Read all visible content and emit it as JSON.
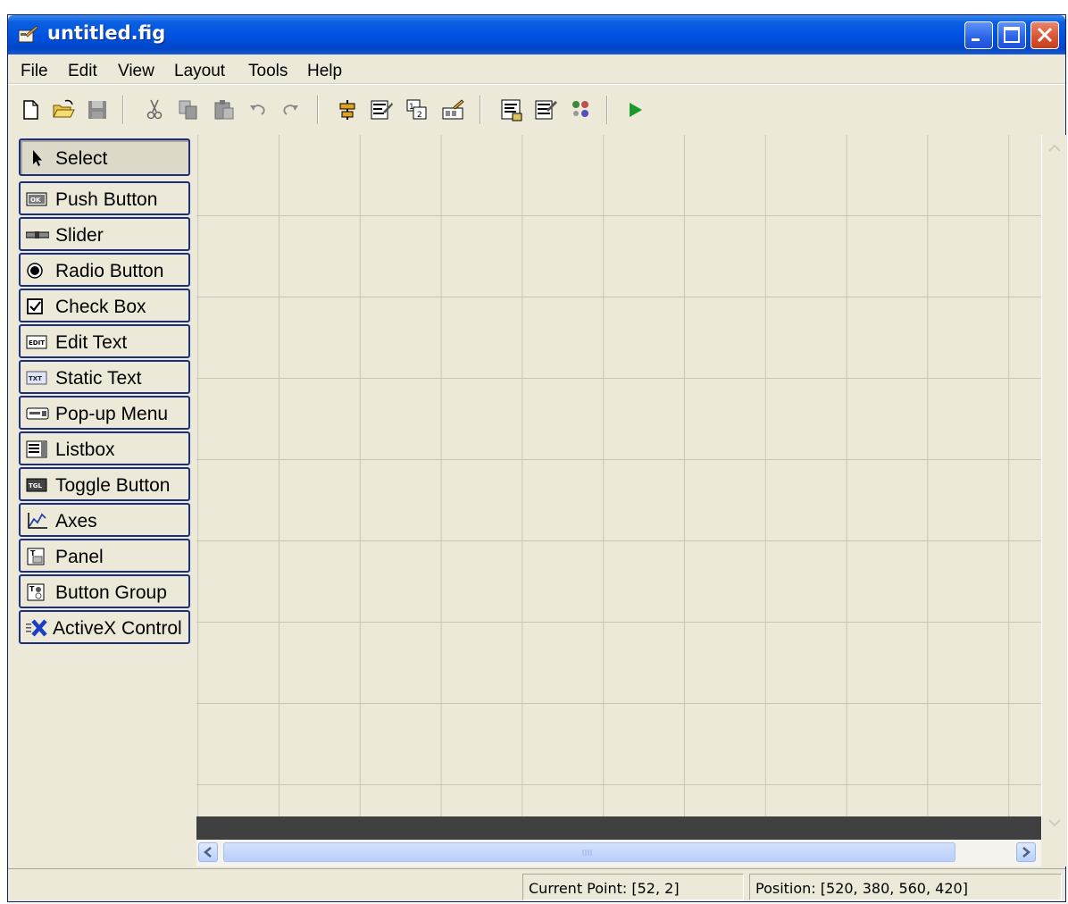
{
  "window": {
    "title": "untitled.fig"
  },
  "menu": [
    "File",
    "Edit",
    "View",
    "Layout",
    "Tools",
    "Help"
  ],
  "toolbar": {
    "tools": [
      "new-file-icon",
      "open-folder-icon",
      "save-icon",
      "cut-icon",
      "copy-icon",
      "paste-icon",
      "undo-icon",
      "redo-icon",
      "align-objects-icon",
      "menu-editor-icon",
      "tab-order-editor-icon",
      "toolbar-editor-icon",
      "m-file-editor-icon",
      "property-inspector-icon",
      "object-browser-icon",
      "run-icon"
    ]
  },
  "palette": {
    "items": [
      {
        "label": "Select",
        "icon": "arrow-cursor-icon",
        "selected": true
      },
      {
        "label": "Push Button",
        "icon": "push-button-icon"
      },
      {
        "label": "Slider",
        "icon": "slider-icon"
      },
      {
        "label": "Radio Button",
        "icon": "radio-button-icon"
      },
      {
        "label": "Check Box",
        "icon": "check-box-icon"
      },
      {
        "label": "Edit Text",
        "icon": "edit-text-icon"
      },
      {
        "label": "Static Text",
        "icon": "static-text-icon"
      },
      {
        "label": "Pop-up Menu",
        "icon": "popup-menu-icon"
      },
      {
        "label": "Listbox",
        "icon": "listbox-icon"
      },
      {
        "label": "Toggle Button",
        "icon": "toggle-button-icon"
      },
      {
        "label": "Axes",
        "icon": "axes-icon"
      },
      {
        "label": "Panel",
        "icon": "panel-icon"
      },
      {
        "label": "Button Group",
        "icon": "button-group-icon"
      },
      {
        "label": "ActiveX Control",
        "icon": "activex-icon"
      }
    ]
  },
  "status": {
    "current_point": "Current Point:  [52, 2]",
    "position": "Position: [520, 380, 560, 420]"
  },
  "colors": {
    "title_bar": "#0054e3",
    "window_bg": "#ece9d8",
    "close_button": "#d8512f",
    "grid_line": "#c9c6b6"
  }
}
